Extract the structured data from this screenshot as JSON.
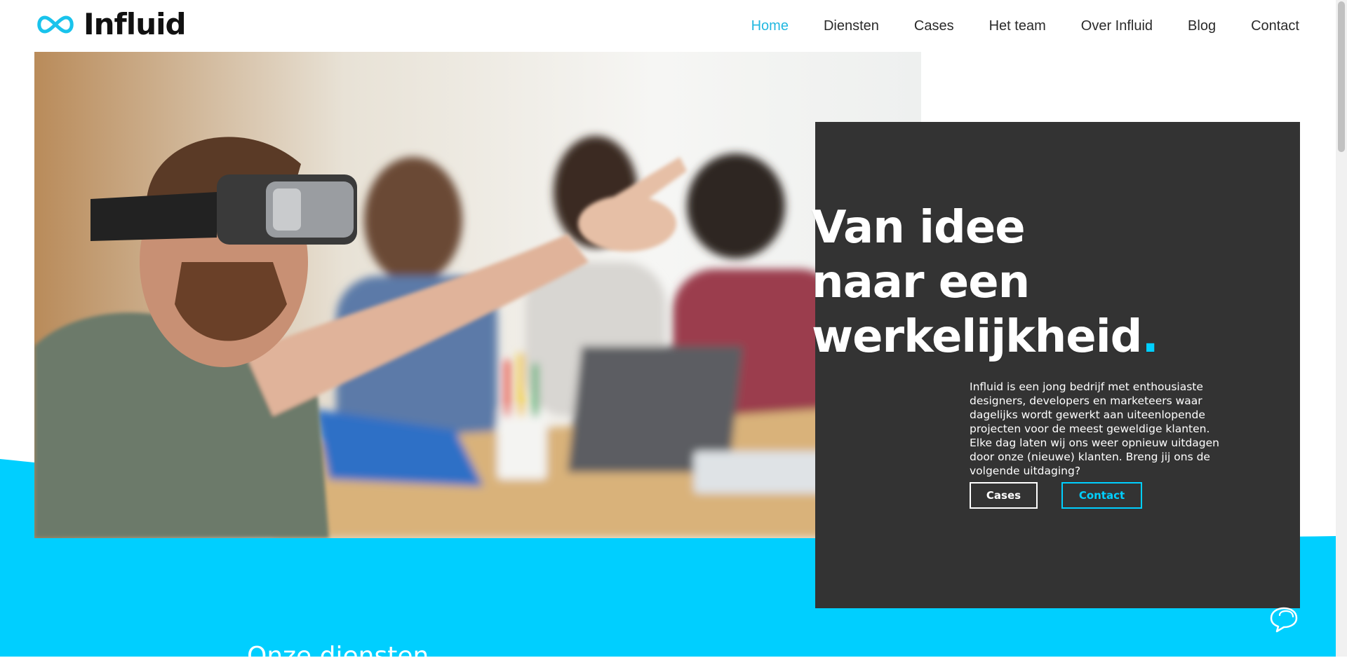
{
  "brand": {
    "name": "Influid",
    "logo_icon": "infinity-icon",
    "accent_color": "#00CFFF"
  },
  "nav": {
    "items": [
      {
        "label": "Home",
        "active": true
      },
      {
        "label": "Diensten",
        "active": false
      },
      {
        "label": "Cases",
        "active": false
      },
      {
        "label": "Het team",
        "active": false
      },
      {
        "label": "Over Influid",
        "active": false
      },
      {
        "label": "Blog",
        "active": false
      },
      {
        "label": "Contact",
        "active": false
      }
    ]
  },
  "hero": {
    "headline": [
      "Van idee",
      "naar een",
      "werkelijkheid"
    ],
    "headline_dot": ".",
    "intro": "Influid is een jong bedrijf met enthousiaste designers, developers en marketeers waar dagelijks wordt gewerkt aan uiteenlopende projecten voor de meest geweldige klanten. Elke dag laten wij ons weer opnieuw uitdagen door onze (nieuwe) klanten. Breng jij ons de volgende uitdaging?",
    "buttons": {
      "cases": "Cases",
      "contact": "Contact"
    },
    "panel_color": "#333333"
  },
  "sections": {
    "services_title": "Onze diensten"
  },
  "widgets": {
    "chat_icon": "chat-bubbles-icon"
  }
}
